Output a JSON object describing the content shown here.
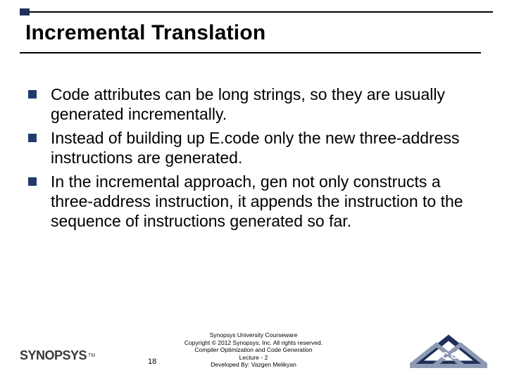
{
  "title": "Incremental Translation",
  "bullets": {
    "0": "Code attributes can be long strings, so they are usually generated incrementally.",
    "1": "Instead of building up E.code only the new three-address instructions are generated.",
    "2": "In the incremental approach, gen not only constructs a three-address instruction, it appends the instruction to the  sequence of instructions generated so far."
  },
  "footer": {
    "logo_text": "SYNOPSYS",
    "tm": "TM",
    "slide_number": "18",
    "credits": {
      "line1": "Synopsys University Courseware",
      "line2": "Copyright © 2012 Synopsys, Inc. All rights reserved.",
      "line3": "Compiler Optimization and Code Generation",
      "line4": "Lecture - 2",
      "line5": "Developed By: Vazgen Melikyan"
    }
  }
}
